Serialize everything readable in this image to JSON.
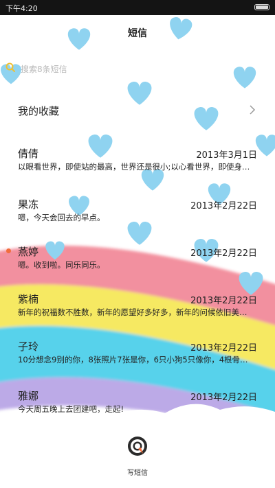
{
  "status_bar": {
    "time": "下午4:20"
  },
  "header": {
    "title": "短信"
  },
  "search": {
    "placeholder": "搜索8条短信"
  },
  "favorites": {
    "label": "我的收藏"
  },
  "messages": [
    {
      "name": "倩倩",
      "date": "2013年3月1日",
      "snippet": "以眼看世界，即使站的最高，世界还是很小;以心看世界，即使身…",
      "unread": false
    },
    {
      "name": "果冻",
      "date": "2013年2月22日",
      "snippet": "嗯，今天会回去的早点。",
      "unread": false
    },
    {
      "name": "燕婷",
      "date": "2013年2月22日",
      "snippet": "嗯。收到啦。同乐同乐。",
      "unread": true
    },
    {
      "name": "紫楠",
      "date": "2013年2月22日",
      "snippet": "新年的祝福数不胜数，新年的愿望好多好多，新年的问候依旧美…",
      "unread": false
    },
    {
      "name": "子玲",
      "date": "2013年2月22日",
      "snippet": "10分想念9别的你，8张照片7张是你，6只小狗5只像你，4根骨…",
      "unread": false
    },
    {
      "name": "雅娜",
      "date": "2013年2月22日",
      "snippet": "今天周五晚上去团建吧，走起!",
      "unread": false
    }
  ],
  "compose": {
    "label": "写短信"
  },
  "colors": {
    "heart": "#8fd3f0",
    "rainbow": [
      "#f28b9a",
      "#f6e85a",
      "#4fd0ea",
      "#b9a6e6"
    ],
    "unread_dot": "#f26d3d",
    "search_icon": "#f0c030"
  }
}
